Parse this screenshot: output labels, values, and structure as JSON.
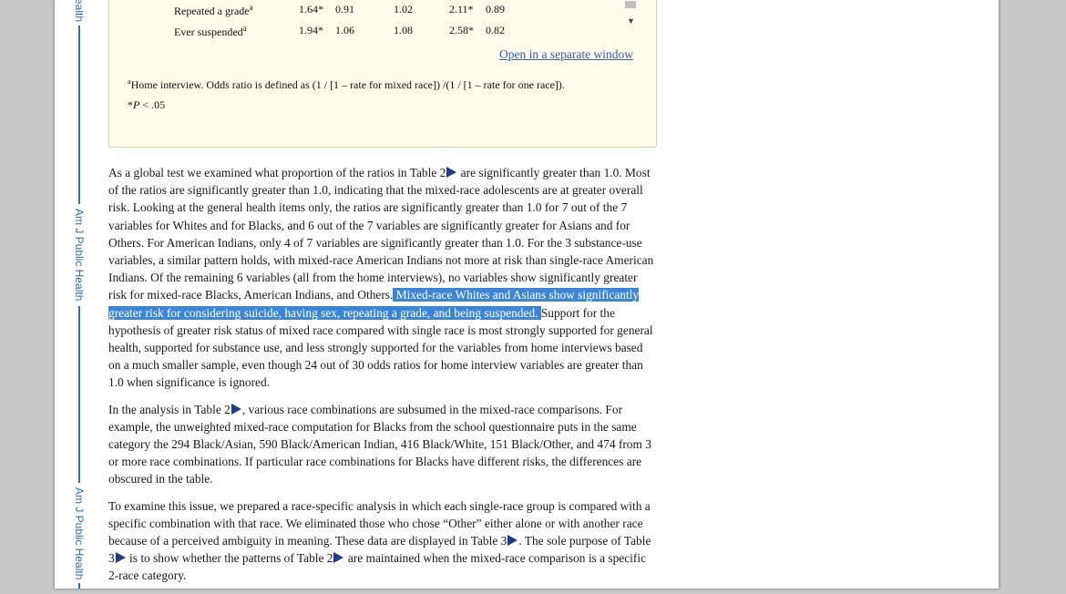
{
  "sidebar": {
    "labels": [
      "ealth",
      "Am J Public Health",
      "Am J Public Health"
    ]
  },
  "table": {
    "rows": [
      {
        "label": "Repeated a grade",
        "sup": "a",
        "cells": [
          "1.64*",
          "0.91",
          "1.02",
          "2.11*",
          "0.89"
        ]
      },
      {
        "label": "Ever suspended",
        "sup": "a",
        "cells": [
          "1.94*",
          "1.06",
          "1.08",
          "2.58*",
          "0.82"
        ]
      }
    ],
    "open_link": "Open in a separate window",
    "footnote_a_sup": "a",
    "footnote_a": "Home interview. Odds ratio is defined as (1 / [1 – rate for mixed race]) /(1 / [1 – rate for one race]).",
    "footnote_p_star": "*",
    "footnote_p_italic": "P",
    "footnote_p_rest": " < .05"
  },
  "paragraphs": {
    "p1_a": "As a global test we examined what proportion of the ratios in Table 2",
    "p1_b": " are significantly greater than 1.0. Most of the ratios are significantly greater than 1.0, indicating that the mixed-race adolescents are at greater overall risk. Looking at the general health items only, the ratios are significantly greater than 1.0 for 7 out of the 7 variables for Whites and for Blacks, and 6 out of the 7 variables are significantly greater for Asians and for Others. For American Indians, only 4 of 7 variables are significantly greater than 1.0. For the 3 substance-use variables, a similar pattern holds, with mixed-race American Indians not more at risk than single-race American Indians. Of the remaining 6 variables (all from the home interviews), no variables show significantly greater risk for mixed-race Blacks, American Indians, and Others.",
    "p1_highlight": " Mixed-race Whites and Asians show significantly greater risk for considering suicide, having sex, repeating a grade, and being suspended. ",
    "p1_c": "Support for the hypothesis of greater risk status of mixed race compared with single race is most strongly supported for general health, supported for substance use, and less strongly supported for the variables from home interviews based on a much smaller sample, even though 24 out of 30 odds ratios for home interview variables are greater than 1.0 when significance is ignored.",
    "p2_a": "In the analysis in Table 2",
    "p2_b": ", various race combinations are subsumed in the mixed-race comparisons. For example, the unweighted mixed-race computation for Blacks from the school questionnaire puts in the same category the 294 Black/Asian, 590 Black/American Indian, 416 Black/White, 151 Black/Other, and 474 from 3 or more race combinations. If particular race combinations for Blacks have different risks, the differences are obscured in the table.",
    "p3_a": "To examine this issue, we prepared a race-specific analysis in which each single-race group is compared with a specific combination with that race. We eliminated those who chose “Other” either alone or with another race because of a perceived ambiguity in meaning. These data are displayed in Table 3",
    "p3_b": ". The sole purpose of Table 3",
    "p3_c": " is to show whether the patterns of Table 2",
    "p3_d": " are maintained when the mixed-race comparison is a specific 2-race category."
  },
  "colors": {
    "link": "#3a5da8",
    "highlight": "#3b86d9",
    "sidebar": "#2f6fb3"
  }
}
